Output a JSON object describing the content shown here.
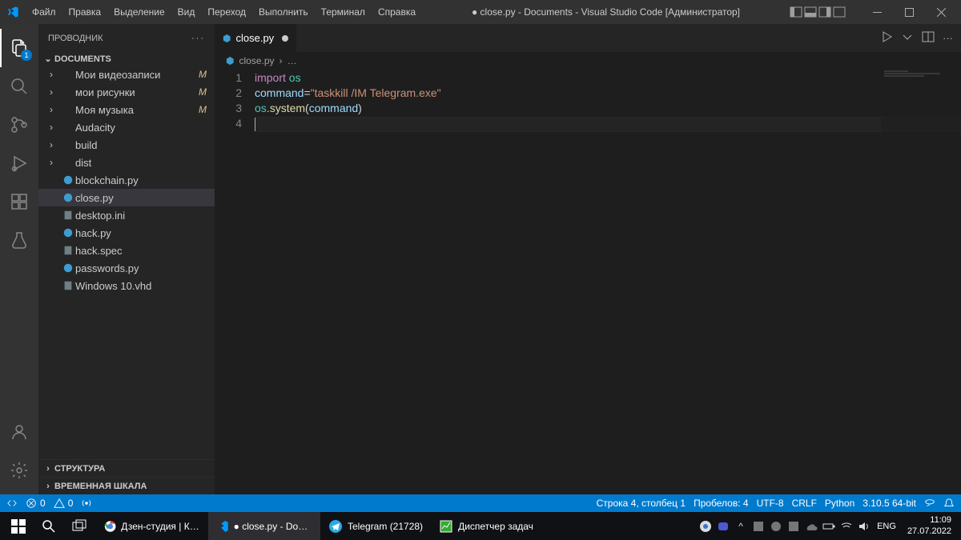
{
  "titlebar": {
    "title": "● close.py - Documents - Visual Studio Code [Администратор]"
  },
  "menu": [
    "Файл",
    "Правка",
    "Выделение",
    "Вид",
    "Переход",
    "Выполнить",
    "Терминал",
    "Справка"
  ],
  "sidebar": {
    "title": "ПРОВОДНИК",
    "root": "DOCUMENTS",
    "items": [
      {
        "name": "Мои видеозаписи",
        "type": "folder",
        "git": "M"
      },
      {
        "name": "мои рисунки",
        "type": "folder",
        "git": "M"
      },
      {
        "name": "Моя музыка",
        "type": "folder",
        "git": "M"
      },
      {
        "name": "Audacity",
        "type": "folder"
      },
      {
        "name": "build",
        "type": "folder"
      },
      {
        "name": "dist",
        "type": "folder"
      },
      {
        "name": "blockchain.py",
        "type": "python"
      },
      {
        "name": "close.py",
        "type": "python",
        "selected": true
      },
      {
        "name": "desktop.ini",
        "type": "ini"
      },
      {
        "name": "hack.py",
        "type": "python"
      },
      {
        "name": "hack.spec",
        "type": "spec"
      },
      {
        "name": "passwords.py",
        "type": "python"
      },
      {
        "name": "Windows 10.vhd",
        "type": "vhd"
      }
    ],
    "sections": {
      "outline": "СТРУКТУРА",
      "timeline": "ВРЕМЕННАЯ ШКАЛА"
    }
  },
  "activity_badge": "1",
  "tab": {
    "name": "close.py",
    "dirty": true
  },
  "breadcrumbs": {
    "file": "close.py",
    "more": "…"
  },
  "code": {
    "line1": {
      "import": "import",
      "os": "os"
    },
    "line2": {
      "command": "command",
      "eq": "=",
      "str": "\"taskkill /IM Telegram.exe\""
    },
    "line3": {
      "os": "os",
      "dot": ".",
      "system": "system",
      "open": "(",
      "arg": "command",
      "close": ")"
    }
  },
  "line_numbers": [
    "1",
    "2",
    "3",
    "4"
  ],
  "statusbar": {
    "errors": "0",
    "warnings": "0",
    "cursor": "Строка 4, столбец 1",
    "spaces": "Пробелов: 4",
    "encoding": "UTF-8",
    "eol": "CRLF",
    "lang": "Python",
    "version": "3.10.5 64-bit"
  },
  "taskbar": {
    "apps": [
      {
        "name": "Дзен-студия | Как з...",
        "icon": "chrome"
      },
      {
        "name": "● close.py - Docum...",
        "icon": "vscode",
        "active": true
      },
      {
        "name": "Telegram (21728)",
        "icon": "telegram"
      },
      {
        "name": "Диспетчер задач",
        "icon": "taskmgr"
      }
    ],
    "lang": "ENG",
    "time": "11:09",
    "date": "27.07.2022"
  }
}
